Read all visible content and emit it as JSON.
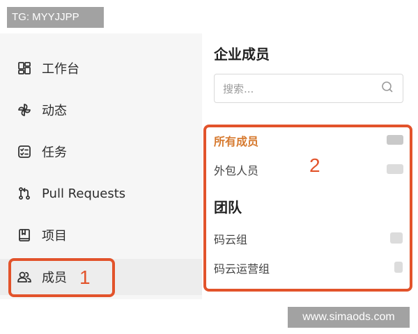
{
  "watermarks": {
    "top": "TG: MYYJJPP",
    "bottom": "www.simaods.com"
  },
  "sidebar": {
    "items": [
      {
        "label": "工作台",
        "icon": "dashboard-icon"
      },
      {
        "label": "动态",
        "icon": "pinwheel-icon"
      },
      {
        "label": "任务",
        "icon": "task-list-icon"
      },
      {
        "label": "Pull Requests",
        "icon": "pull-request-icon"
      },
      {
        "label": "项目",
        "icon": "project-book-icon"
      },
      {
        "label": "成员",
        "icon": "members-icon",
        "active": true
      }
    ]
  },
  "panel": {
    "title": "企业成员",
    "search": {
      "placeholder": "搜索..."
    },
    "members": [
      {
        "label": "所有成员",
        "selected": true
      },
      {
        "label": "外包人员"
      }
    ],
    "team_heading": "团队",
    "teams": [
      {
        "label": "码云组"
      },
      {
        "label": "码云运营组"
      }
    ]
  },
  "annotations": {
    "marker_1": "1",
    "marker_2": "2",
    "color": "#e2532b"
  },
  "colors": {
    "selected_text": "#d6792e",
    "sidebar_bg": "#f6f6f6",
    "active_bg": "#ededed"
  }
}
